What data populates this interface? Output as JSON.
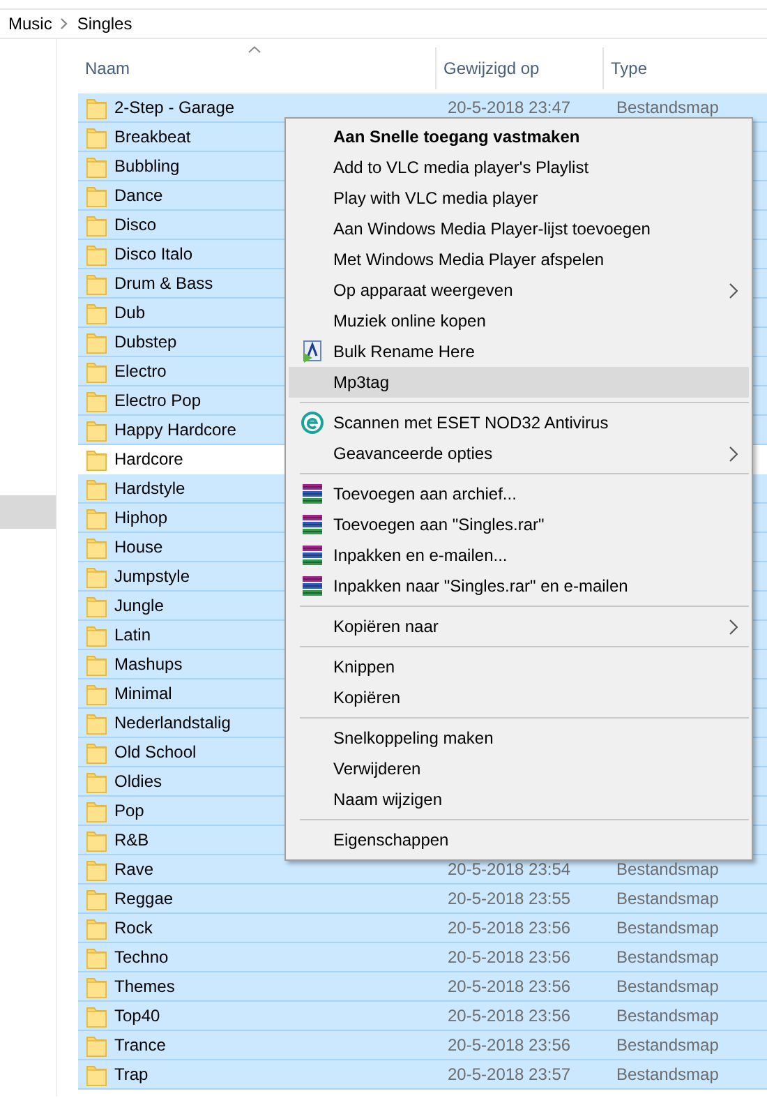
{
  "breadcrumb": [
    "Music",
    "Singles"
  ],
  "columns": [
    {
      "label": "Naam",
      "sorted": true
    },
    {
      "label": "Gewijzigd op",
      "sorted": false
    },
    {
      "label": "Type",
      "sorted": false
    }
  ],
  "rows": [
    {
      "name": "2-Step - Garage",
      "selected": true,
      "modified": "20-5-2018 23:47",
      "type": "Bestandsmap"
    },
    {
      "name": "Breakbeat",
      "selected": true
    },
    {
      "name": "Bubbling",
      "selected": true
    },
    {
      "name": "Dance",
      "selected": true
    },
    {
      "name": "Disco",
      "selected": true
    },
    {
      "name": "Disco Italo",
      "selected": true
    },
    {
      "name": "Drum & Bass",
      "selected": true
    },
    {
      "name": "Dub",
      "selected": true
    },
    {
      "name": "Dubstep",
      "selected": true
    },
    {
      "name": "Electro",
      "selected": true
    },
    {
      "name": "Electro Pop",
      "selected": true
    },
    {
      "name": "Happy Hardcore",
      "selected": true
    },
    {
      "name": "Hardcore",
      "selected": false
    },
    {
      "name": "Hardstyle",
      "selected": true
    },
    {
      "name": "Hiphop",
      "selected": true
    },
    {
      "name": "House",
      "selected": true
    },
    {
      "name": "Jumpstyle",
      "selected": true
    },
    {
      "name": "Jungle",
      "selected": true
    },
    {
      "name": "Latin",
      "selected": true
    },
    {
      "name": "Mashups",
      "selected": true
    },
    {
      "name": "Minimal",
      "selected": true
    },
    {
      "name": "Nederlandstalig",
      "selected": true
    },
    {
      "name": "Old School",
      "selected": true
    },
    {
      "name": "Oldies",
      "selected": true
    },
    {
      "name": "Pop",
      "selected": true
    },
    {
      "name": "R&B",
      "selected": true
    },
    {
      "name": "Rave",
      "selected": true,
      "modified": "20-5-2018 23:54",
      "type": "Bestandsmap"
    },
    {
      "name": "Reggae",
      "selected": true,
      "modified": "20-5-2018 23:55",
      "type": "Bestandsmap"
    },
    {
      "name": "Rock",
      "selected": true,
      "modified": "20-5-2018 23:56",
      "type": "Bestandsmap"
    },
    {
      "name": "Techno",
      "selected": true,
      "modified": "20-5-2018 23:56",
      "type": "Bestandsmap"
    },
    {
      "name": "Themes",
      "selected": true,
      "modified": "20-5-2018 23:56",
      "type": "Bestandsmap"
    },
    {
      "name": "Top40",
      "selected": true,
      "modified": "20-5-2018 23:56",
      "type": "Bestandsmap"
    },
    {
      "name": "Trance",
      "selected": true,
      "modified": "20-5-2018 23:56",
      "type": "Bestandsmap"
    },
    {
      "name": "Trap",
      "selected": true,
      "modified": "20-5-2018 23:57",
      "type": "Bestandsmap"
    }
  ],
  "context_menu": [
    {
      "kind": "plain",
      "label": "Aan Snelle toegang vastmaken",
      "bold": true,
      "hovered": false,
      "submenu": false
    },
    {
      "kind": "plain",
      "label": "Add to VLC media player's Playlist",
      "bold": false,
      "hovered": false,
      "submenu": false
    },
    {
      "kind": "plain",
      "label": "Play with VLC media player",
      "bold": false,
      "hovered": false,
      "submenu": false
    },
    {
      "kind": "plain",
      "label": "Aan Windows Media Player-lijst toevoegen",
      "bold": false,
      "hovered": false,
      "submenu": false
    },
    {
      "kind": "plain",
      "label": "Met Windows Media Player afspelen",
      "bold": false,
      "hovered": false,
      "submenu": false
    },
    {
      "kind": "plain",
      "label": "Op apparaat weergeven",
      "bold": false,
      "hovered": false,
      "submenu": true
    },
    {
      "kind": "plain",
      "label": "Muziek online kopen",
      "bold": false,
      "hovered": false,
      "submenu": false
    },
    {
      "kind": "rename",
      "label": "Bulk Rename Here",
      "bold": false,
      "hovered": false,
      "submenu": false
    },
    {
      "kind": "plain",
      "label": "Mp3tag",
      "bold": false,
      "hovered": true,
      "submenu": false
    },
    {
      "kind": "separator"
    },
    {
      "kind": "antivirus",
      "label": "Scannen met ESET NOD32 Antivirus",
      "bold": false,
      "hovered": false,
      "submenu": false
    },
    {
      "kind": "plain",
      "label": "Geavanceerde opties",
      "bold": false,
      "hovered": false,
      "submenu": true
    },
    {
      "kind": "separator"
    },
    {
      "kind": "archive",
      "label": "Toevoegen aan archief...",
      "bold": false,
      "hovered": false,
      "submenu": false
    },
    {
      "kind": "archive",
      "label": "Toevoegen aan \"Singles.rar\"",
      "bold": false,
      "hovered": false,
      "submenu": false
    },
    {
      "kind": "archive",
      "label": "Inpakken en e-mailen...",
      "bold": false,
      "hovered": false,
      "submenu": false
    },
    {
      "kind": "archive",
      "label": "Inpakken naar \"Singles.rar\" en e-mailen",
      "bold": false,
      "hovered": false,
      "submenu": false
    },
    {
      "kind": "separator"
    },
    {
      "kind": "plain",
      "label": "Kopiëren naar",
      "bold": false,
      "hovered": false,
      "submenu": true
    },
    {
      "kind": "separator"
    },
    {
      "kind": "plain",
      "label": "Knippen",
      "bold": false,
      "hovered": false,
      "submenu": false
    },
    {
      "kind": "plain",
      "label": "Kopiëren",
      "bold": false,
      "hovered": false,
      "submenu": false
    },
    {
      "kind": "separator"
    },
    {
      "kind": "plain",
      "label": "Snelkoppeling maken",
      "bold": false,
      "hovered": false,
      "submenu": false
    },
    {
      "kind": "plain",
      "label": "Verwijderen",
      "bold": false,
      "hovered": false,
      "submenu": false
    },
    {
      "kind": "plain",
      "label": "Naam wijzigen",
      "bold": false,
      "hovered": false,
      "submenu": false
    },
    {
      "kind": "separator"
    },
    {
      "kind": "plain",
      "label": "Eigenschappen",
      "bold": false,
      "hovered": false,
      "submenu": false
    }
  ]
}
